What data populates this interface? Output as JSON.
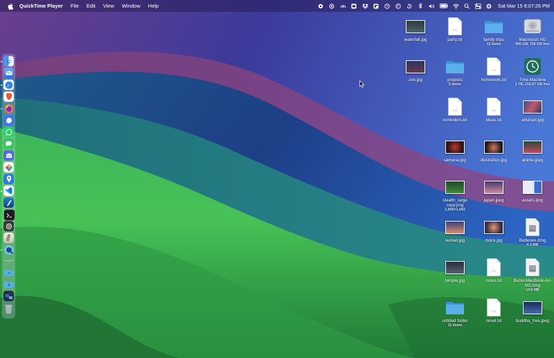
{
  "menubar": {
    "app_name": "QuickTime Player",
    "menus": [
      "File",
      "Edit",
      "View",
      "Window",
      "Help"
    ],
    "status_icons": [
      "settings-icon",
      "hotspot-icon",
      "camera-icon",
      "screenshot-icon",
      "dropbox-icon",
      "grid-icon",
      "timer-icon",
      "clock-icon",
      "history-icon",
      "bluetooth-icon",
      "volume-icon",
      "battery-icon",
      "wifi-icon",
      "search-icon",
      "control-center-icon",
      "siri-icon"
    ],
    "clock": "Sat Mar 15  8:07:26 PM"
  },
  "dock": {
    "apps": [
      "finder",
      "mail",
      "safari",
      "brave",
      "firefox",
      "signal",
      "whatsapp",
      "messages",
      "discord",
      "photos",
      "maps",
      "vscode",
      "xcode",
      "terminal",
      "chatgpt",
      "notes",
      "quicktime"
    ],
    "stacks": [
      "documents-folder",
      "downloads-folder",
      "screenshots-stack",
      "trash"
    ]
  },
  "desktop": {
    "items": [
      {
        "name": "waterfall.jpg",
        "sub": "",
        "kind": "image"
      },
      {
        "name": "party.txt",
        "sub": "",
        "kind": "text"
      },
      {
        "name": "family trips",
        "sub": "12 items",
        "kind": "folder"
      },
      {
        "name": "Macintosh HD",
        "sub": "995 GB, 706 GB free",
        "kind": "drive"
      },
      {
        "name": "zen.jpg",
        "sub": "",
        "kind": "image"
      },
      {
        "name": "projects",
        "sub": "5 items",
        "kind": "folder"
      },
      {
        "name": "homework.txt",
        "sub": "",
        "kind": "text"
      },
      {
        "name": "Time Machine",
        "sub": "1 TB, 219.67 GB free",
        "kind": "timemachine"
      },
      {
        "name": "reminders.txt",
        "sub": "",
        "kind": "text"
      },
      {
        "name": "ideas.txt",
        "sub": "",
        "kind": "text"
      },
      {
        "name": "abstract.jpg",
        "sub": "",
        "kind": "image"
      },
      {
        "name": "samurai.jpg",
        "sub": "",
        "kind": "image"
      },
      {
        "name": "illustration.jpg",
        "sub": "",
        "kind": "image"
      },
      {
        "name": "anime.jpeg",
        "sub": "",
        "kind": "image"
      },
      {
        "name": "stealth_large copy.png",
        "sub": "1,600×1,043",
        "kind": "image"
      },
      {
        "name": "japan.jpeg",
        "sub": "",
        "kind": "image"
      },
      {
        "name": "assets.png",
        "sub": "",
        "kind": "image"
      },
      {
        "name": "sunset.jpg",
        "sub": "",
        "kind": "image"
      },
      {
        "name": "monk.jpg",
        "sub": "",
        "kind": "image"
      },
      {
        "name": "Batteries.dmg",
        "sub": "4.3 MB",
        "kind": "dmg"
      },
      {
        "name": "temple.jpg",
        "sub": "",
        "kind": "image"
      },
      {
        "name": "notes.txt",
        "sub": "",
        "kind": "text"
      },
      {
        "name": "Bezel-MacBook-Air-M3.dmg",
        "sub": "14.9 MB",
        "kind": "dmg"
      },
      {
        "name": "untitled folder",
        "sub": "11 items",
        "kind": "folder"
      },
      {
        "name": "novel.txt",
        "sub": "",
        "kind": "text"
      },
      {
        "name": "buddha_tree.jpeg",
        "sub": "",
        "kind": "image"
      }
    ]
  },
  "colors": {
    "folder": "#5ab0ea",
    "menubar_bg": "#2d2060"
  }
}
